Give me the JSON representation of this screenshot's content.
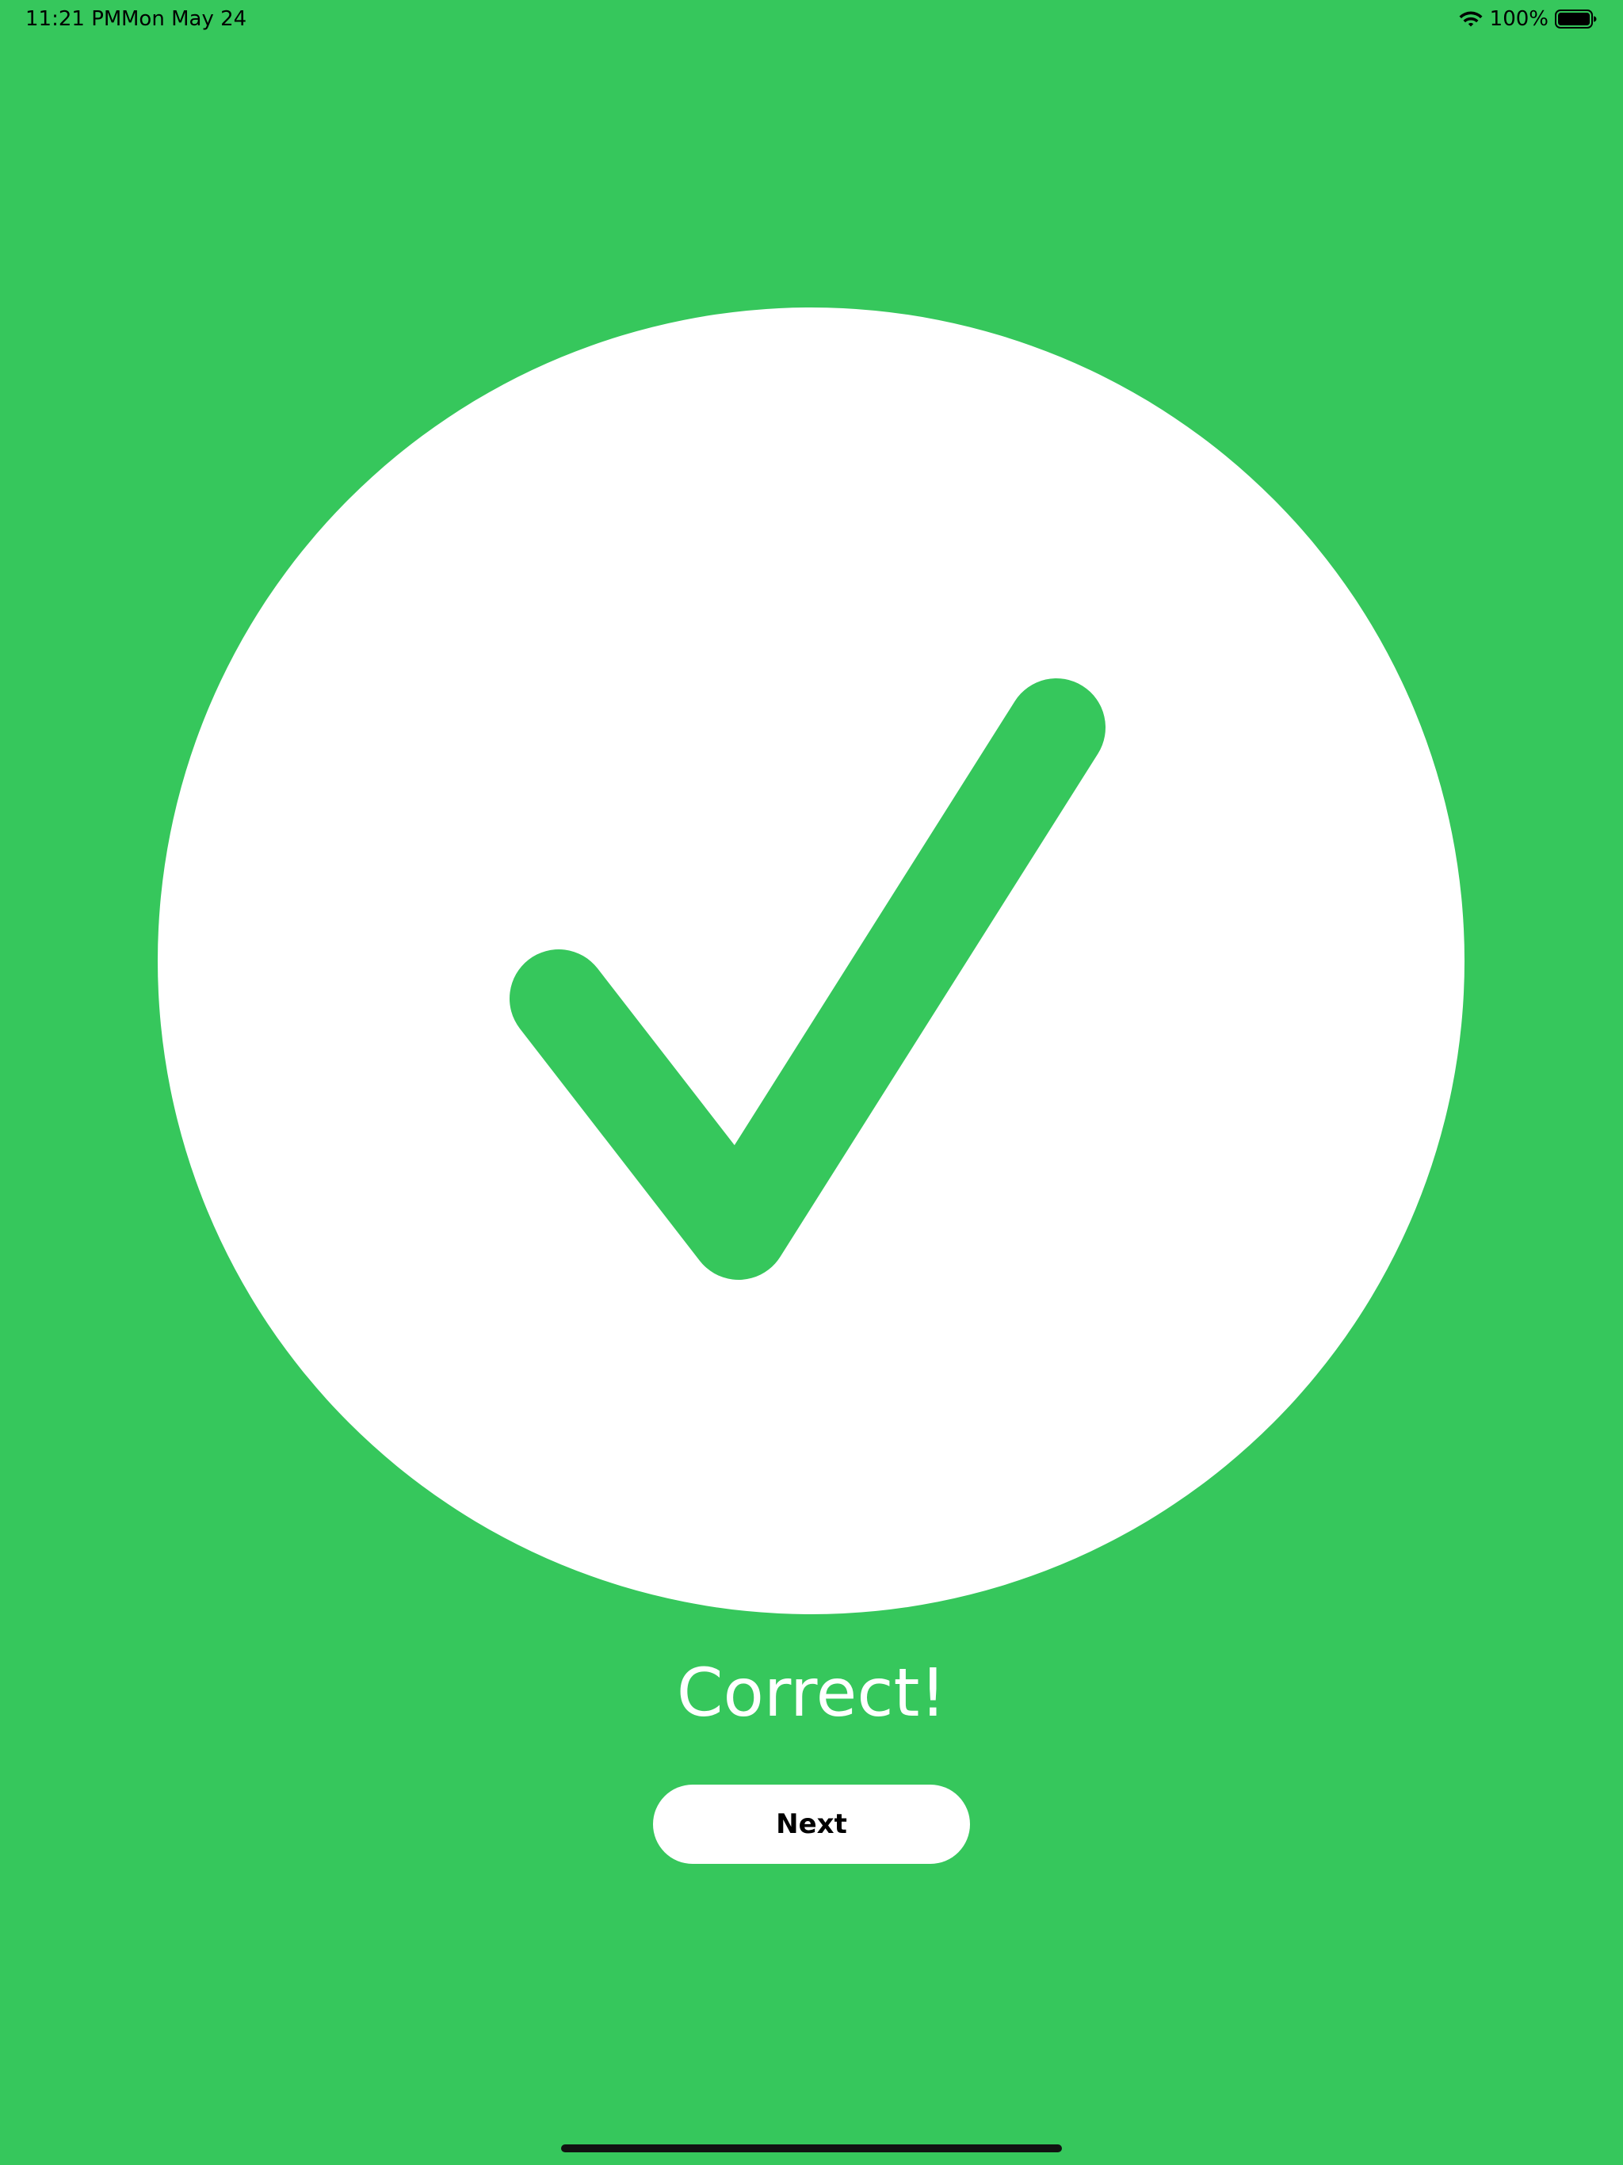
{
  "colors": {
    "background": "#36C75C",
    "circle": "#FFFFFF",
    "check": "#36C75C",
    "text": "#FFFFFF",
    "button_text": "#000000"
  },
  "status_bar": {
    "time": "11:21 PM",
    "date": "Mon May 24",
    "battery_percent": "100%",
    "wifi_icon": "wifi-icon",
    "battery_icon": "battery-icon"
  },
  "result": {
    "icon": "checkmark-icon",
    "title": "Correct!"
  },
  "actions": {
    "next_label": "Next"
  }
}
